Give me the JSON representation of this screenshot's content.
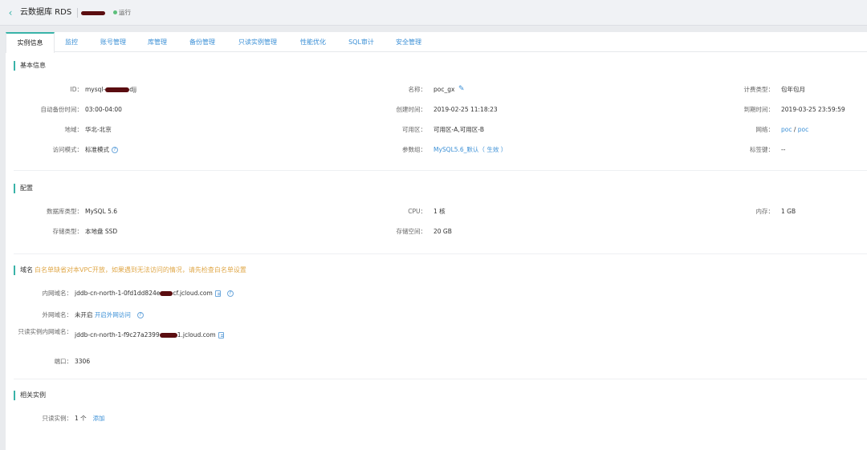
{
  "header": {
    "back_glyph": "‹",
    "title": "云数据库 RDS",
    "status": "运行"
  },
  "tabs": [
    "实例信息",
    "监控",
    "账号管理",
    "库管理",
    "备份管理",
    "只读实例管理",
    "性能优化",
    "SQL审计",
    "安全管理"
  ],
  "basic": {
    "title": "基本信息",
    "id_label": "ID：",
    "id_prefix": "mysql-",
    "id_suffix": "djj",
    "name_label": "名称：",
    "name_value": "poc_gx",
    "billing_label": "计费类型：",
    "billing_value": "包年包月",
    "backup_label": "自动备份时间：",
    "backup_value": "03:00-04:00",
    "created_label": "创建时间：",
    "created_value": "2019-02-25 11:18:23",
    "expire_label": "到期时间：",
    "expire_value": "2019-03-25 23:59:59",
    "region_label": "地域：",
    "region_value": "华北-北京",
    "az_label": "可用区：",
    "az_value": "可用区-A,可用区-B",
    "network_label": "网络：",
    "network_vpc": "poc",
    "network_sep": " / ",
    "network_subnet": "poc",
    "access_label": "访问模式：",
    "access_value": "标准模式",
    "param_label": "参数组：",
    "param_value": "MySQL5.6_默认（ 生效 ）",
    "tag_label": "标签键：",
    "tag_value": "--"
  },
  "config": {
    "title": "配置",
    "dbtype_label": "数据库类型：",
    "dbtype_value": "MySQL 5.6",
    "cpu_label": "CPU：",
    "cpu_value": "1 核",
    "mem_label": "内存：",
    "mem_value": "1 GB",
    "storage_type_label": "存储类型：",
    "storage_type_value": "本地盘 SSD",
    "storage_space_label": "存储空间：",
    "storage_space_value": "20 GB"
  },
  "domain": {
    "title": "域名",
    "note": "白名单缺省对本VPC开放，如果遇到无法访问的情况，请先检查白名单设置",
    "internal_label": "内网域名：",
    "internal_prefix": "jddb-cn-north-1-0fd1dd824e",
    "internal_suffix": "cf.jcloud.com",
    "external_label": "外网域名：",
    "external_value": "未开启",
    "external_link": "开启外网访问",
    "readonly_label": "只读实例内网域名：",
    "readonly_prefix": "jddb-cn-north-1-f9c27a2399",
    "readonly_suffix": "1.jcloud.com",
    "port_label": "端口：",
    "port_value": "3306"
  },
  "related": {
    "title": "相关实例",
    "readonly_label": "只读实例：",
    "readonly_count": "1 个",
    "add_link": "添加"
  },
  "icons": {
    "help": "question-circle-icon",
    "copy": "copy-icon",
    "edit": "pencil-icon",
    "status": "status-dot-icon"
  },
  "colors": {
    "accent": "#39b3a8",
    "link": "#3a8fd6",
    "warning": "#e0a84a",
    "running": "#5cbf7b",
    "redaction": "#5a0d10"
  }
}
